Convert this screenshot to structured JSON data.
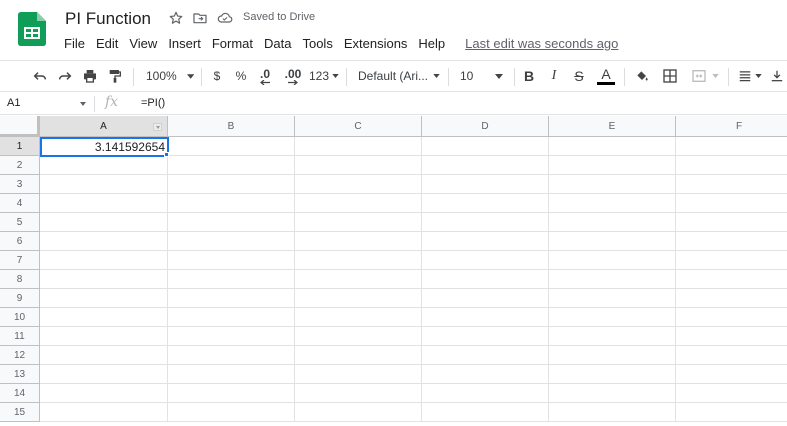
{
  "app": {
    "title": "PI Function",
    "saved_status": "Saved to Drive",
    "brand_color": "#0f9d58"
  },
  "menu": {
    "items": [
      "File",
      "Edit",
      "View",
      "Insert",
      "Format",
      "Data",
      "Tools",
      "Extensions",
      "Help"
    ],
    "last_edit": "Last edit was seconds ago"
  },
  "toolbar": {
    "zoom": "100%",
    "currency": "$",
    "percent": "%",
    "decrease_decimal": ".0",
    "increase_decimal": ".00",
    "more_formats": "123",
    "font": "Default (Ari...",
    "font_size": "10",
    "bold": "B",
    "italic": "I",
    "strikethrough": "S",
    "text_color": "A"
  },
  "formula_bar": {
    "name_box": "A1",
    "fx": "fx",
    "formula": "=PI()"
  },
  "sheet": {
    "columns": [
      "A",
      "B",
      "C",
      "D",
      "E",
      "F"
    ],
    "rows": [
      "1",
      "2",
      "3",
      "4",
      "5",
      "6",
      "7",
      "8",
      "9",
      "10",
      "11",
      "12",
      "13",
      "14",
      "15"
    ],
    "active_cell": "A1",
    "a1_value": "3.141592654",
    "selection_color": "#1a73e8"
  }
}
